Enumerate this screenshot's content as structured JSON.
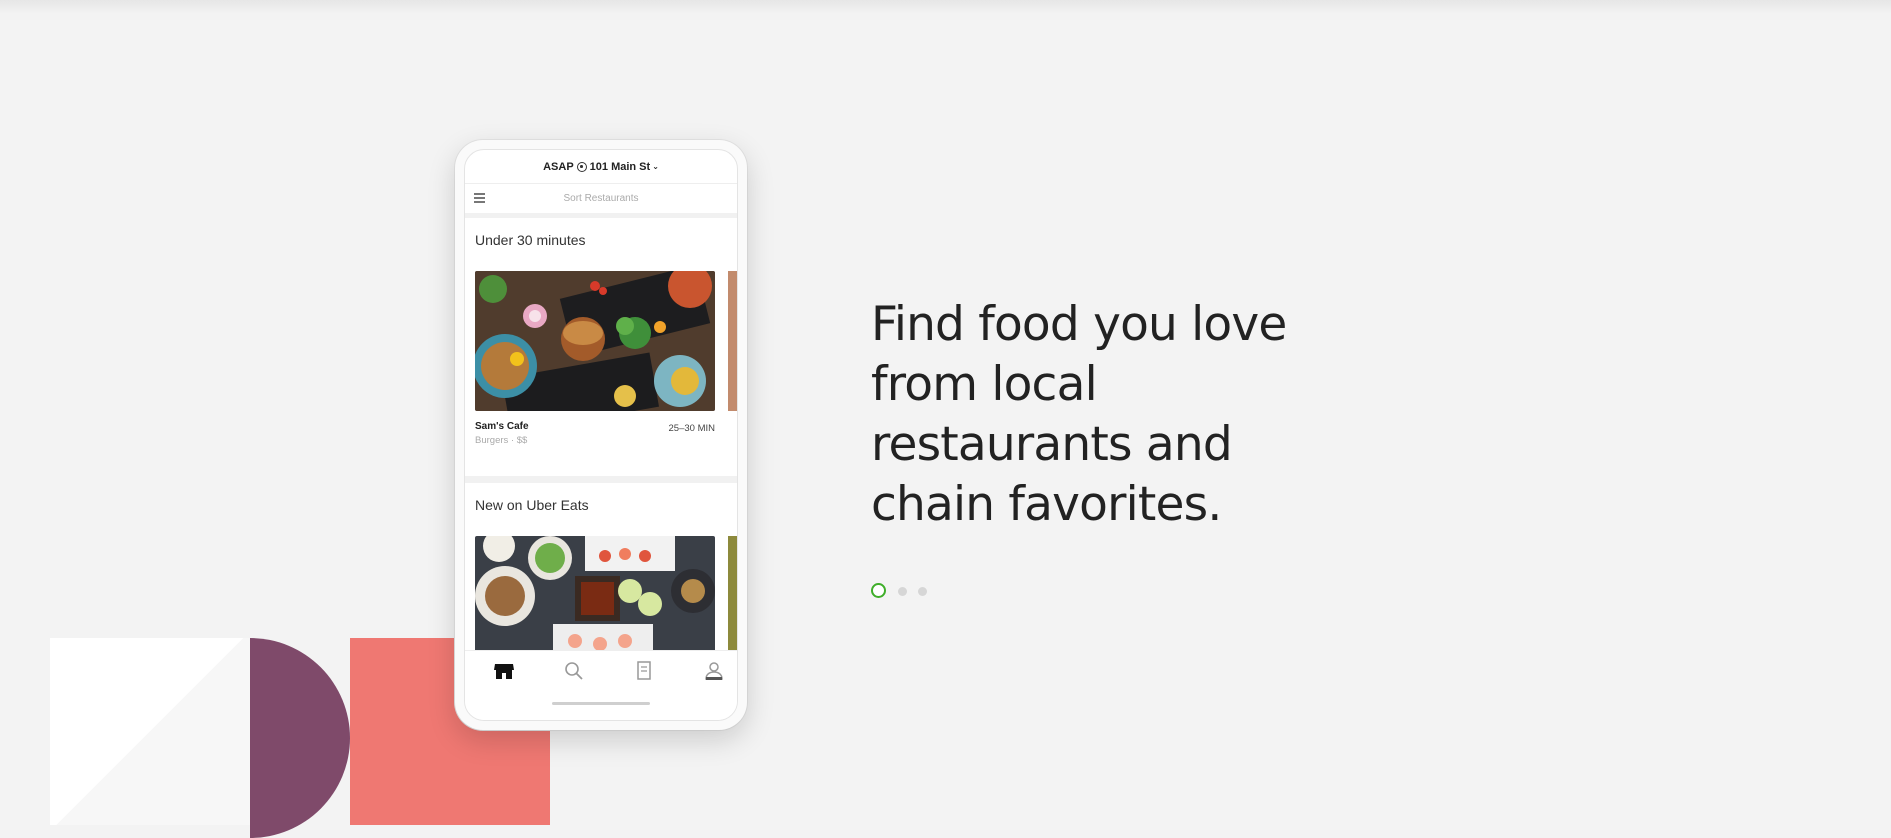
{
  "phone": {
    "header": {
      "asap": "ASAP",
      "address": "101 Main St"
    },
    "sort_placeholder": "Sort Restaurants",
    "sections": [
      {
        "title": "Under 30 minutes",
        "card": {
          "name": "Sam's Cafe",
          "sub": "Burgers · $$",
          "time": "25–30 MIN"
        }
      },
      {
        "title": "New on Uber Eats"
      }
    ],
    "tabs": [
      "home-icon",
      "search-icon",
      "orders-icon",
      "account-icon"
    ]
  },
  "headline": "Find food you love from local restaurants and chain favorites.",
  "carousel": {
    "count": 3,
    "active": 0,
    "active_color": "#3fae2a"
  },
  "colors": {
    "background": "#f3f3f3",
    "shape_purple": "#7f4a6a",
    "shape_coral": "#ef7872"
  }
}
